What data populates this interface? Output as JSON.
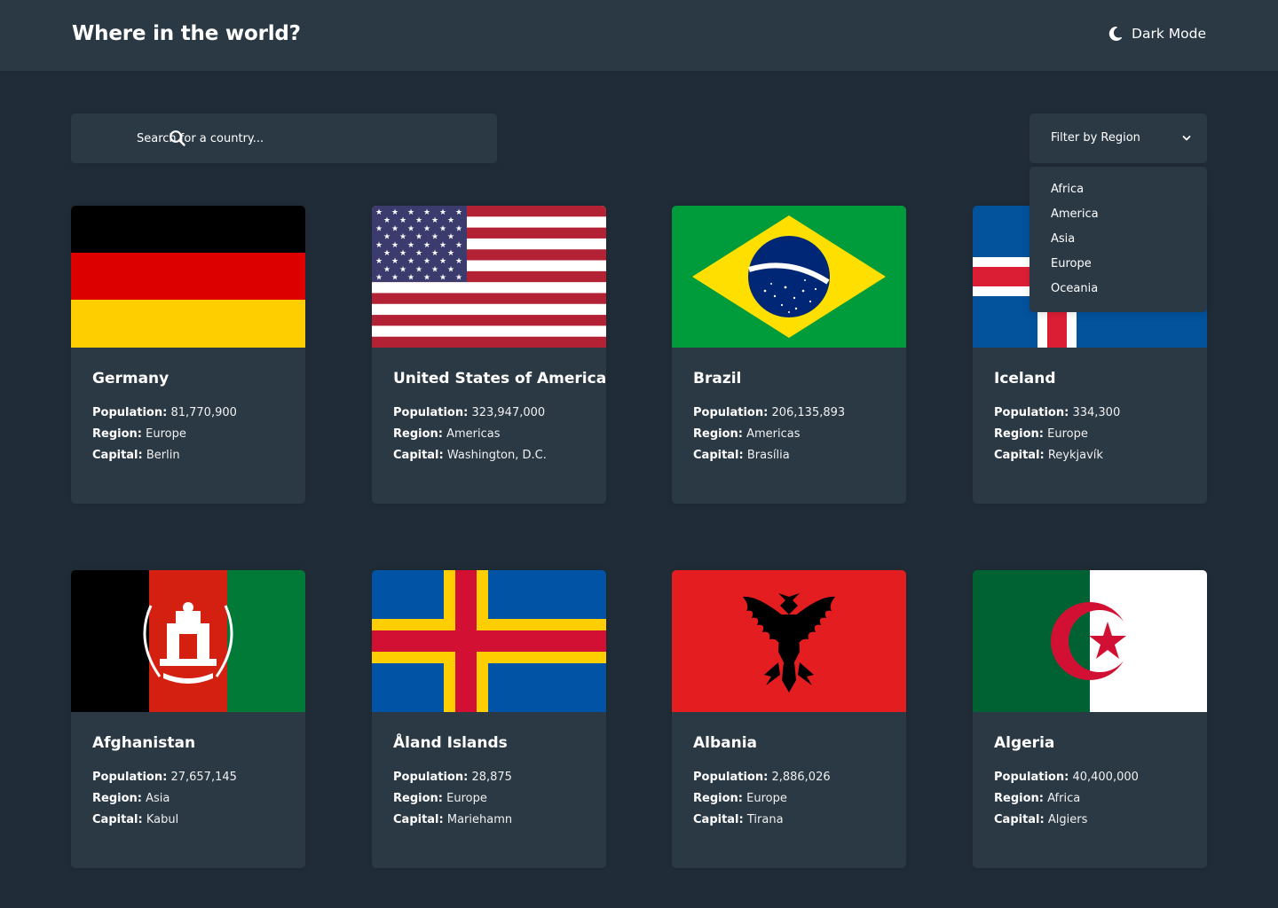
{
  "header": {
    "title": "Where in the world?",
    "theme_toggle_label": "Dark Mode"
  },
  "search": {
    "placeholder": "Search for a country...",
    "value": ""
  },
  "filter": {
    "label": "Filter by Region",
    "options": [
      "Africa",
      "America",
      "Asia",
      "Europe",
      "Oceania"
    ]
  },
  "labels": {
    "population": "Population:",
    "region": "Region:",
    "capital": "Capital:"
  },
  "countries": [
    {
      "name": "Germany",
      "population": "81,770,900",
      "region": "Europe",
      "capital": "Berlin",
      "flag": "germany-flag"
    },
    {
      "name": "United States of America",
      "population": "323,947,000",
      "region": "Americas",
      "capital": "Washington, D.C.",
      "flag": "usa-flag"
    },
    {
      "name": "Brazil",
      "population": "206,135,893",
      "region": "Americas",
      "capital": "Brasília",
      "flag": "brazil-flag"
    },
    {
      "name": "Iceland",
      "population": "334,300",
      "region": "Europe",
      "capital": "Reykjavík",
      "flag": "iceland-flag"
    },
    {
      "name": "Afghanistan",
      "population": "27,657,145",
      "region": "Asia",
      "capital": "Kabul",
      "flag": "afghanistan-flag"
    },
    {
      "name": "Åland Islands",
      "population": "28,875",
      "region": "Europe",
      "capital": "Mariehamn",
      "flag": "aland-flag"
    },
    {
      "name": "Albania",
      "population": "2,886,026",
      "region": "Europe",
      "capital": "Tirana",
      "flag": "albania-flag"
    },
    {
      "name": "Algeria",
      "population": "40,400,000",
      "region": "Africa",
      "capital": "Algiers",
      "flag": "algeria-flag"
    }
  ],
  "colors": {
    "background": "#202c37",
    "elements": "#2b3945",
    "text": "#ffffff"
  }
}
